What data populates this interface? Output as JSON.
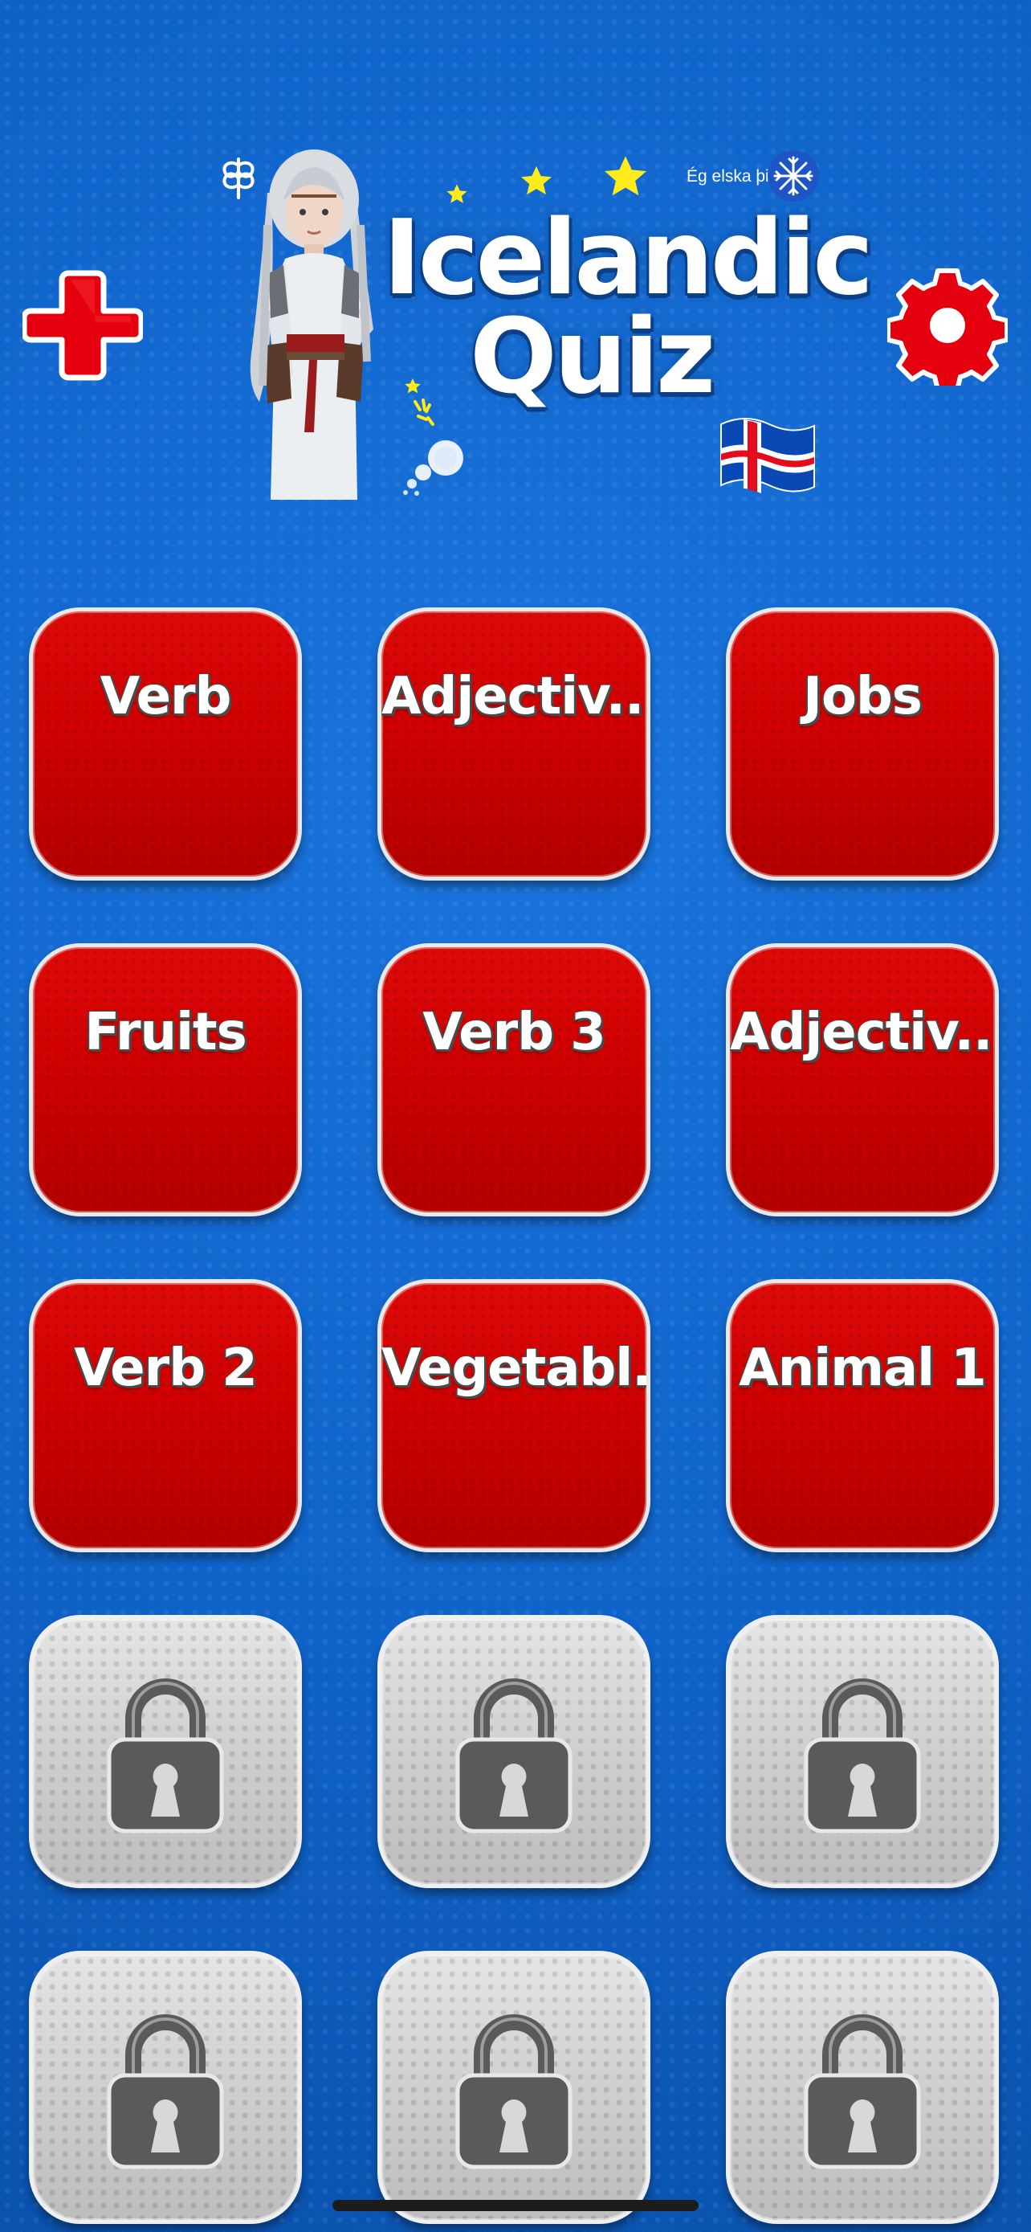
{
  "header": {
    "title_line_1": "Icelandic",
    "title_line_2": "Quiz",
    "tagline": "Ég elska þig",
    "add_icon": "plus-icon",
    "settings_icon": "gear-icon"
  },
  "colors": {
    "background": "#0f63c9",
    "tile_red": "#cf0000",
    "tile_locked": "#cfcfcf",
    "title_text": "#ffffff",
    "label_shadow": "#4a4a4a",
    "accent_red": "#e4000f"
  },
  "categories": [
    {
      "label": "Verb",
      "locked": false
    },
    {
      "label": "Adjectiv...",
      "locked": false
    },
    {
      "label": "Jobs",
      "locked": false
    },
    {
      "label": "Fruits",
      "locked": false
    },
    {
      "label": "Verb 3",
      "locked": false
    },
    {
      "label": "Adjectiv...",
      "locked": false
    },
    {
      "label": "Verb 2",
      "locked": false
    },
    {
      "label": "Vegetabl...",
      "locked": false
    },
    {
      "label": "Animal 1",
      "locked": false
    },
    {
      "label": "",
      "locked": true,
      "icon": "lock-icon"
    },
    {
      "label": "",
      "locked": true,
      "icon": "lock-icon"
    },
    {
      "label": "",
      "locked": true,
      "icon": "lock-icon"
    },
    {
      "label": "",
      "locked": true,
      "icon": "lock-icon"
    },
    {
      "label": "",
      "locked": true,
      "icon": "lock-icon"
    },
    {
      "label": "",
      "locked": true,
      "icon": "lock-icon"
    }
  ]
}
